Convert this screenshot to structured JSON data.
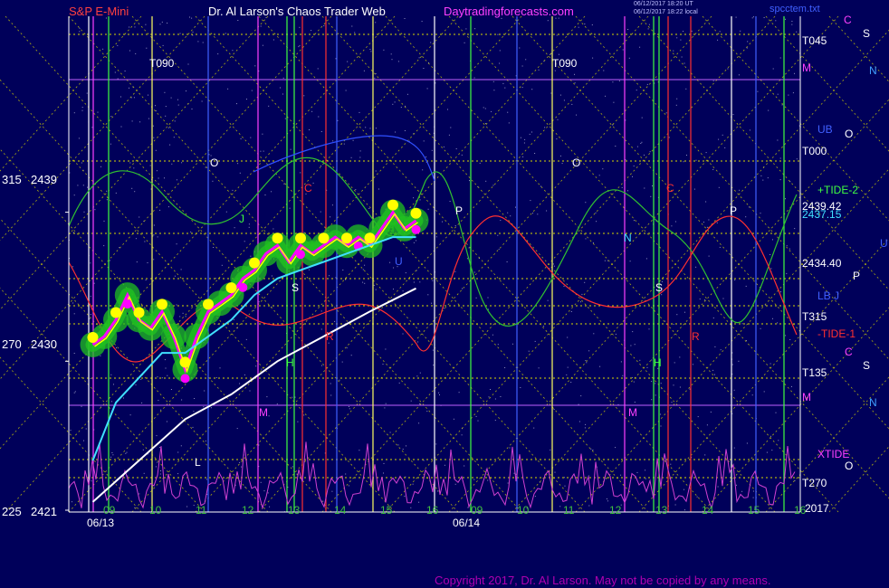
{
  "header": {
    "instrument": "S&P E-Mini",
    "site": "Dr. Al Larson's Chaos Trader Web",
    "domain": "Daytradingforecasts.com",
    "stamp1": "06/12/2017 18:20 UT",
    "stamp2": "06/12/2017 18:22 local",
    "file": "spcctem.txt"
  },
  "copyright": "Copyright 2017, Dr. Al Larson. May not be copied by any means.",
  "colors": {
    "background": "#00005a",
    "cyan_line": "#40e0ff",
    "white_line": "#ffffff",
    "price_yellow": "#ffff00",
    "price_magenta": "#ff00ff",
    "band_green": "#20c020",
    "tide_red": "#ff3030",
    "tide_green": "#30c030",
    "oscillator": "#d040d0",
    "grid_yellow": "#d8d800"
  },
  "chart_data": {
    "type": "line",
    "title": "S&P E-Mini",
    "y_left_labels": [
      {
        "angle": "315",
        "price": "2439"
      },
      {
        "angle": "270",
        "price": "2430"
      },
      {
        "angle": "225",
        "price": "2421"
      }
    ],
    "ylim": [
      2421,
      2445
    ],
    "x_hours_day1": [
      "09",
      "10",
      "11",
      "12",
      "13",
      "14",
      "15",
      "16"
    ],
    "x_hours_day2": [
      "09",
      "10",
      "11",
      "12",
      "13",
      "14",
      "15",
      "16"
    ],
    "dates": [
      "06/13",
      "06/14"
    ],
    "year": "2017",
    "top_markers": [
      "T090",
      "T090"
    ],
    "right_labels": [
      {
        "text": "T045",
        "color": "#ffffff"
      },
      {
        "text": "UB",
        "color": "#4060ff"
      },
      {
        "text": "T000",
        "color": "#ffffff"
      },
      {
        "text": "+TIDE-2",
        "color": "#40ff40"
      },
      {
        "text": "2439.42",
        "color": "#ffffff"
      },
      {
        "text": "2437.15",
        "color": "#40e0ff"
      },
      {
        "text": "2434.40",
        "color": "#ffffff"
      },
      {
        "text": "LB J",
        "color": "#4060ff"
      },
      {
        "text": "T315",
        "color": "#ffffff"
      },
      {
        "text": "-TIDE-1",
        "color": "#ff3030"
      },
      {
        "text": "T135",
        "color": "#ffffff"
      },
      {
        "text": "XTIDE",
        "color": "#ff40ff"
      },
      {
        "text": "T270",
        "color": "#ffffff"
      }
    ],
    "planet_glyphs_right": [
      "C",
      "S",
      "N",
      "M",
      "O",
      "U",
      "P",
      "C",
      "S",
      "N",
      "M",
      "O"
    ],
    "in_chart_glyphs": [
      "O",
      "C",
      "S",
      "R",
      "H",
      "M",
      "U",
      "J",
      "P",
      "L",
      "N"
    ],
    "price_series": {
      "name": "price",
      "x_hours": [
        9.0,
        9.25,
        9.5,
        9.75,
        10.0,
        10.25,
        10.5,
        10.75,
        11.0,
        11.25,
        11.5,
        11.75,
        12.0,
        12.25,
        12.5,
        12.75,
        13.0,
        13.25,
        13.5,
        13.75,
        14.0,
        14.25,
        14.5,
        14.75,
        15.0,
        15.25,
        15.5,
        15.75,
        16.0
      ],
      "values": [
        2431.0,
        2431.5,
        2432.5,
        2434.0,
        2432.5,
        2432.0,
        2433.0,
        2431.5,
        2429.5,
        2431.5,
        2433.0,
        2433.5,
        2434.0,
        2435.0,
        2435.5,
        2436.5,
        2437.0,
        2436.0,
        2437.0,
        2436.5,
        2437.0,
        2437.5,
        2437.0,
        2437.5,
        2437.0,
        2438.0,
        2439.0,
        2438.0,
        2438.5
      ]
    },
    "cyan_series": {
      "name": "2437.15",
      "x_hours": [
        9.0,
        9.5,
        10.0,
        10.5,
        11.0,
        11.5,
        12.0,
        12.5,
        13.0,
        13.5,
        14.0,
        14.5,
        15.0,
        15.5,
        16.0
      ],
      "values": [
        2424.0,
        2427.5,
        2429.0,
        2430.5,
        2430.5,
        2431.5,
        2432.5,
        2434.0,
        2435.0,
        2435.5,
        2436.0,
        2436.5,
        2437.0,
        2437.5,
        2437.5
      ]
    },
    "white_series": {
      "name": "2434.40",
      "x_hours": [
        9.0,
        10.0,
        11.0,
        12.0,
        13.0,
        14.0,
        15.0,
        16.0
      ],
      "values": [
        2421.5,
        2424.0,
        2426.5,
        2428.0,
        2430.0,
        2431.5,
        2433.0,
        2434.4
      ]
    }
  }
}
